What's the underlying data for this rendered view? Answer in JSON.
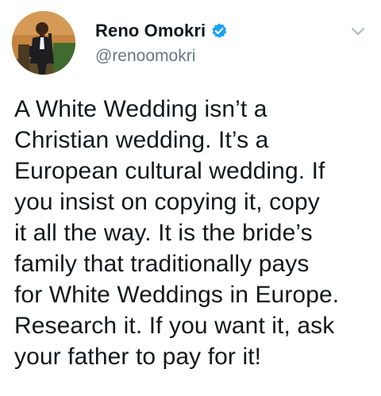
{
  "author": {
    "display_name": "Reno Omokri",
    "handle": "@renoomokri",
    "verified": true
  },
  "icons": {
    "avatar": "profile-photo",
    "verified": "verified-badge-icon",
    "menu": "chevron-down-icon"
  },
  "colors": {
    "verified_blue": "#1da1f2",
    "handle_gray": "#657786",
    "text": "#14171a"
  },
  "tweet": {
    "text": "A White Wedding isn’t a\nChristian wedding. It’s a\nEuropean cultural wedding. If\nyou insist on copying it, copy\nit all the way. It is the bride’s\nfamily that traditionally pays\nfor White Weddings in Europe.\nResearch it. If you want it, ask\nyour father to pay for it!"
  }
}
